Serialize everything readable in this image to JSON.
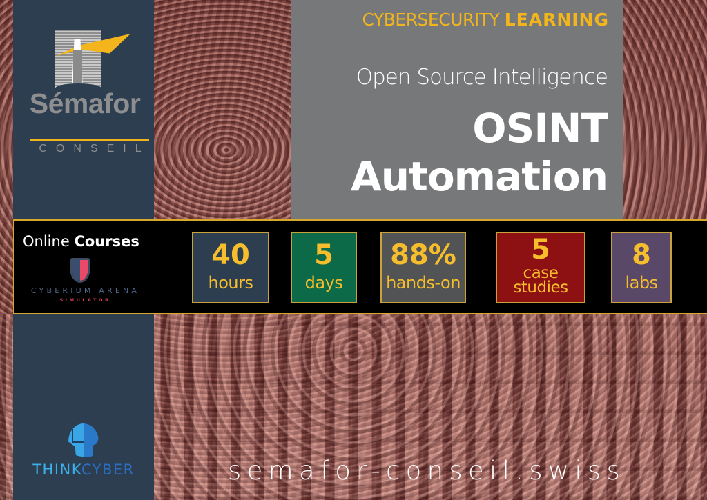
{
  "brand": {
    "name": "Sémafor",
    "subname": "CONSEIL",
    "colors": {
      "slate": "#2c3e4f",
      "gold": "#f2b51c",
      "grey_panel": "#77787a"
    }
  },
  "header": {
    "kicker_regular": "CYBERSECURITY",
    "kicker_bold": "LEARNING",
    "subtitle": "Open Source Intelligence",
    "title_line1": "OSINT",
    "title_line2": "Automation"
  },
  "band": {
    "online_regular": "Online",
    "online_bold": "Courses",
    "partner_name": "CYBERIUM ARENA",
    "partner_tagline": "SIMULATOR",
    "partner_icon": "shield-icon",
    "stats": [
      {
        "value": "40",
        "label": "hours",
        "color": "#2c3e4f"
      },
      {
        "value": "5",
        "label": "days",
        "color": "#0c6a48"
      },
      {
        "value": "88%",
        "label": "hands-on",
        "color": "#525355"
      },
      {
        "value": "5",
        "label_line1": "case",
        "label_line2": "studies",
        "color": "#8d1112"
      },
      {
        "value": "8",
        "label": "labs",
        "color": "#594868"
      }
    ]
  },
  "footer": {
    "partner_part1": "THINK",
    "partner_part2": "CYBER",
    "partner_icon": "brain-head-icon",
    "website": "semafor-conseil.swiss"
  }
}
